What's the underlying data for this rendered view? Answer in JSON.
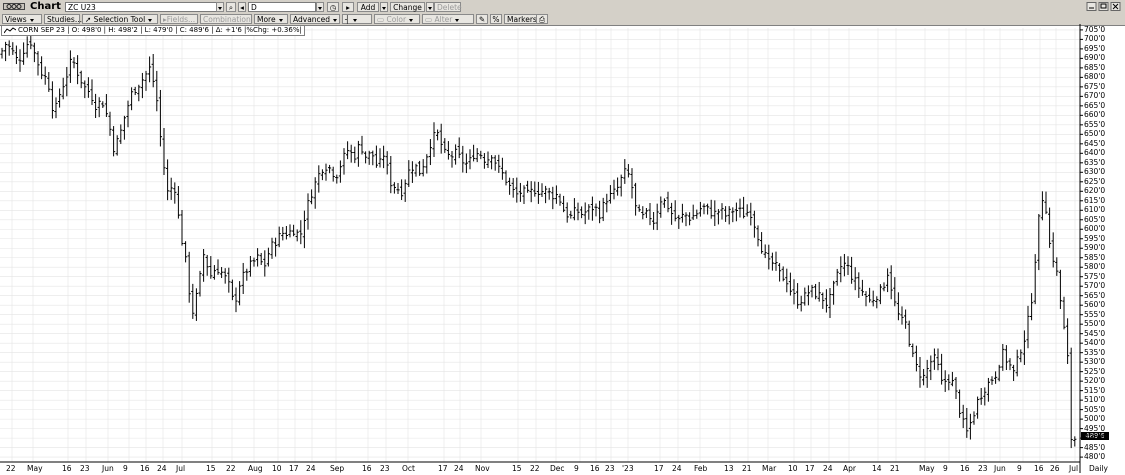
{
  "window": {
    "title": "Chart",
    "symbol": "ZC U23",
    "interval_field": "D"
  },
  "toolbar": {
    "views": "Views",
    "studies": "Studies...",
    "selection_tool": "Selection Tool",
    "fields": "Fields...",
    "combination": "Combination",
    "more": "More",
    "advanced": "Advanced",
    "color": "Color",
    "alter": "Alter",
    "percent": "%",
    "markers": "Markers",
    "add": "Add",
    "change": "Change",
    "delete": "Delete"
  },
  "info": {
    "text": "CORN SEP 23 | O: 498'0 | H: 498'2 | L: 479'0 | C: 489'6 | Δ: +1'6 |%Chg: +0.36%|"
  },
  "last_price": "489'6",
  "colors": {
    "bars": "#000000",
    "grid": "#e4e4e4",
    "background": "#ffffff",
    "chrome": "#d4d0c8"
  },
  "chart_data": {
    "type": "ohlc",
    "instrument": "CORN SEP 23",
    "period": "Daily",
    "ylim": [
      479,
      706
    ],
    "yticks": [
      "705'0",
      "700'0",
      "695'0",
      "690'0",
      "685'0",
      "680'0",
      "675'0",
      "670'0",
      "665'0",
      "660'0",
      "655'0",
      "650'0",
      "645'0",
      "640'0",
      "635'0",
      "630'0",
      "625'0",
      "620'0",
      "615'0",
      "610'0",
      "605'0",
      "600'0",
      "595'0",
      "590'0",
      "585'0",
      "580'0",
      "575'0",
      "570'0",
      "565'0",
      "560'0",
      "555'0",
      "550'0",
      "545'0",
      "540'0",
      "535'0",
      "530'0",
      "525'0",
      "520'0",
      "515'0",
      "510'0",
      "505'0",
      "500'0",
      "495'0",
      "490'0",
      "485'0",
      "480'0"
    ],
    "xticks": [
      "22",
      "May",
      "16",
      "23",
      "Jun",
      "9",
      "16",
      "24",
      "Jul",
      "15",
      "22",
      "Aug",
      "10",
      "17",
      "24",
      "Sep",
      "16",
      "23",
      "Oct",
      "17",
      "24",
      "Nov",
      "15",
      "22",
      "Dec",
      "9",
      "16",
      "23",
      "'23",
      "17",
      "24",
      "Feb",
      "13",
      "21",
      "Mar",
      "10",
      "17",
      "24",
      "Apr",
      "14",
      "21",
      "May",
      "9",
      "16",
      "23",
      "Jun",
      "9",
      "16",
      "26",
      "Jul",
      "Daily"
    ],
    "close_path": [
      [
        0,
        692
      ],
      [
        6,
        698
      ],
      [
        12,
        694
      ],
      [
        18,
        688
      ],
      [
        24,
        695
      ],
      [
        30,
        700
      ],
      [
        36,
        690
      ],
      [
        42,
        682
      ],
      [
        48,
        678
      ],
      [
        54,
        660
      ],
      [
        60,
        672
      ],
      [
        66,
        680
      ],
      [
        72,
        690
      ],
      [
        78,
        682
      ],
      [
        84,
        675
      ],
      [
        90,
        672
      ],
      [
        96,
        665
      ],
      [
        102,
        668
      ],
      [
        108,
        658
      ],
      [
        114,
        642
      ],
      [
        120,
        650
      ],
      [
        126,
        662
      ],
      [
        132,
        672
      ],
      [
        138,
        676
      ],
      [
        144,
        680
      ],
      [
        150,
        685
      ],
      [
        156,
        672
      ],
      [
        162,
        640
      ],
      [
        168,
        618
      ],
      [
        174,
        625
      ],
      [
        180,
        600
      ],
      [
        186,
        582
      ],
      [
        192,
        555
      ],
      [
        198,
        568
      ],
      [
        204,
        588
      ],
      [
        210,
        575
      ],
      [
        216,
        580
      ],
      [
        222,
        577
      ],
      [
        228,
        572
      ],
      [
        234,
        560
      ],
      [
        240,
        572
      ],
      [
        246,
        578
      ],
      [
        252,
        582
      ],
      [
        258,
        585
      ],
      [
        264,
        580
      ],
      [
        270,
        590
      ],
      [
        276,
        594
      ],
      [
        282,
        598
      ],
      [
        288,
        598
      ],
      [
        294,
        600
      ],
      [
        300,
        596
      ],
      [
        306,
        610
      ],
      [
        312,
        620
      ],
      [
        318,
        628
      ],
      [
        324,
        634
      ],
      [
        330,
        632
      ],
      [
        336,
        628
      ],
      [
        342,
        636
      ],
      [
        348,
        642
      ],
      [
        354,
        638
      ],
      [
        360,
        645
      ],
      [
        366,
        638
      ],
      [
        372,
        640
      ],
      [
        378,
        632
      ],
      [
        384,
        640
      ],
      [
        390,
        625
      ],
      [
        396,
        622
      ],
      [
        402,
        620
      ],
      [
        408,
        630
      ],
      [
        414,
        634
      ],
      [
        420,
        630
      ],
      [
        426,
        638
      ],
      [
        432,
        648
      ],
      [
        438,
        650
      ],
      [
        444,
        640
      ],
      [
        450,
        638
      ],
      [
        456,
        640
      ],
      [
        462,
        636
      ],
      [
        468,
        634
      ],
      [
        474,
        640
      ],
      [
        480,
        640
      ],
      [
        486,
        636
      ],
      [
        492,
        640
      ],
      [
        498,
        632
      ],
      [
        504,
        628
      ],
      [
        510,
        622
      ],
      [
        516,
        618
      ],
      [
        522,
        620
      ],
      [
        528,
        618
      ],
      [
        534,
        621
      ],
      [
        540,
        620
      ],
      [
        546,
        620
      ],
      [
        552,
        618
      ],
      [
        558,
        618
      ],
      [
        564,
        610
      ],
      [
        570,
        606
      ],
      [
        576,
        610
      ],
      [
        582,
        608
      ],
      [
        588,
        610
      ],
      [
        594,
        612
      ],
      [
        600,
        608
      ],
      [
        606,
        616
      ],
      [
        612,
        618
      ],
      [
        618,
        622
      ],
      [
        624,
        630
      ],
      [
        630,
        628
      ],
      [
        636,
        610
      ],
      [
        642,
        606
      ],
      [
        648,
        608
      ],
      [
        654,
        604
      ],
      [
        660,
        616
      ],
      [
        666,
        614
      ],
      [
        672,
        608
      ],
      [
        678,
        604
      ],
      [
        684,
        608
      ],
      [
        690,
        606
      ],
      [
        696,
        608
      ],
      [
        702,
        612
      ],
      [
        708,
        610
      ],
      [
        714,
        608
      ],
      [
        720,
        610
      ],
      [
        726,
        607
      ],
      [
        732,
        610
      ],
      [
        738,
        610
      ],
      [
        744,
        608
      ],
      [
        750,
        610
      ],
      [
        756,
        600
      ],
      [
        762,
        590
      ],
      [
        768,
        582
      ],
      [
        774,
        582
      ],
      [
        780,
        576
      ],
      [
        786,
        574
      ],
      [
        792,
        566
      ],
      [
        798,
        562
      ],
      [
        804,
        564
      ],
      [
        810,
        568
      ],
      [
        816,
        566
      ],
      [
        822,
        564
      ],
      [
        828,
        560
      ],
      [
        834,
        570
      ],
      [
        840,
        580
      ],
      [
        846,
        582
      ],
      [
        852,
        575
      ],
      [
        858,
        570
      ],
      [
        864,
        566
      ],
      [
        870,
        562
      ],
      [
        876,
        565
      ],
      [
        882,
        568
      ],
      [
        888,
        578
      ],
      [
        894,
        562
      ],
      [
        900,
        552
      ],
      [
        906,
        550
      ],
      [
        912,
        534
      ],
      [
        918,
        525
      ],
      [
        924,
        522
      ],
      [
        930,
        530
      ],
      [
        936,
        532
      ],
      [
        942,
        518
      ],
      [
        948,
        522
      ],
      [
        954,
        518
      ],
      [
        960,
        504
      ],
      [
        966,
        492
      ],
      [
        972,
        500
      ],
      [
        978,
        510
      ],
      [
        984,
        516
      ],
      [
        990,
        520
      ],
      [
        996,
        524
      ],
      [
        1002,
        535
      ],
      [
        1008,
        530
      ],
      [
        1014,
        524
      ],
      [
        1020,
        536
      ],
      [
        1026,
        545
      ],
      [
        1032,
        565
      ],
      [
        1038,
        602
      ],
      [
        1044,
        622
      ],
      [
        1050,
        590
      ],
      [
        1056,
        580
      ],
      [
        1062,
        556
      ],
      [
        1068,
        530
      ],
      [
        1070,
        490
      ],
      [
        1075,
        489.75
      ]
    ],
    "high_path": [
      [
        0,
        697
      ],
      [
        30,
        703
      ],
      [
        60,
        678
      ],
      [
        90,
        677
      ],
      [
        120,
        655
      ],
      [
        150,
        690
      ],
      [
        180,
        606
      ],
      [
        192,
        562
      ],
      [
        204,
        614
      ],
      [
        234,
        566
      ],
      [
        264,
        588
      ],
      [
        294,
        606
      ],
      [
        324,
        640
      ],
      [
        354,
        650
      ],
      [
        384,
        645
      ],
      [
        414,
        638
      ],
      [
        438,
        655
      ],
      [
        468,
        640
      ],
      [
        498,
        645
      ],
      [
        528,
        626
      ],
      [
        558,
        624
      ],
      [
        588,
        615
      ],
      [
        624,
        633
      ],
      [
        660,
        624
      ],
      [
        690,
        612
      ],
      [
        720,
        614
      ],
      [
        750,
        614
      ],
      [
        780,
        584
      ],
      [
        810,
        574
      ],
      [
        840,
        586
      ],
      [
        870,
        570
      ],
      [
        888,
        582
      ],
      [
        900,
        558
      ],
      [
        930,
        540
      ],
      [
        960,
        515
      ],
      [
        990,
        530
      ],
      [
        1020,
        544
      ],
      [
        1044,
        626
      ],
      [
        1062,
        565
      ],
      [
        1070,
        498
      ]
    ],
    "low_path": [
      [
        0,
        686
      ],
      [
        30,
        693
      ],
      [
        60,
        654
      ],
      [
        90,
        666
      ],
      [
        120,
        638
      ],
      [
        150,
        674
      ],
      [
        180,
        592
      ],
      [
        192,
        552
      ],
      [
        204,
        570
      ],
      [
        234,
        554
      ],
      [
        264,
        575
      ],
      [
        294,
        590
      ],
      [
        324,
        626
      ],
      [
        354,
        632
      ],
      [
        384,
        618
      ],
      [
        414,
        625
      ],
      [
        438,
        642
      ],
      [
        468,
        632
      ],
      [
        498,
        626
      ],
      [
        528,
        612
      ],
      [
        558,
        608
      ],
      [
        588,
        602
      ],
      [
        624,
        618
      ],
      [
        660,
        600
      ],
      [
        690,
        600
      ],
      [
        720,
        604
      ],
      [
        750,
        602
      ],
      [
        780,
        570
      ],
      [
        810,
        556
      ],
      [
        840,
        572
      ],
      [
        870,
        558
      ],
      [
        888,
        560
      ],
      [
        900,
        546
      ],
      [
        930,
        516
      ],
      [
        960,
        488
      ],
      [
        990,
        510
      ],
      [
        1020,
        518
      ],
      [
        1044,
        598
      ],
      [
        1062,
        548
      ],
      [
        1070,
        479
      ]
    ]
  }
}
